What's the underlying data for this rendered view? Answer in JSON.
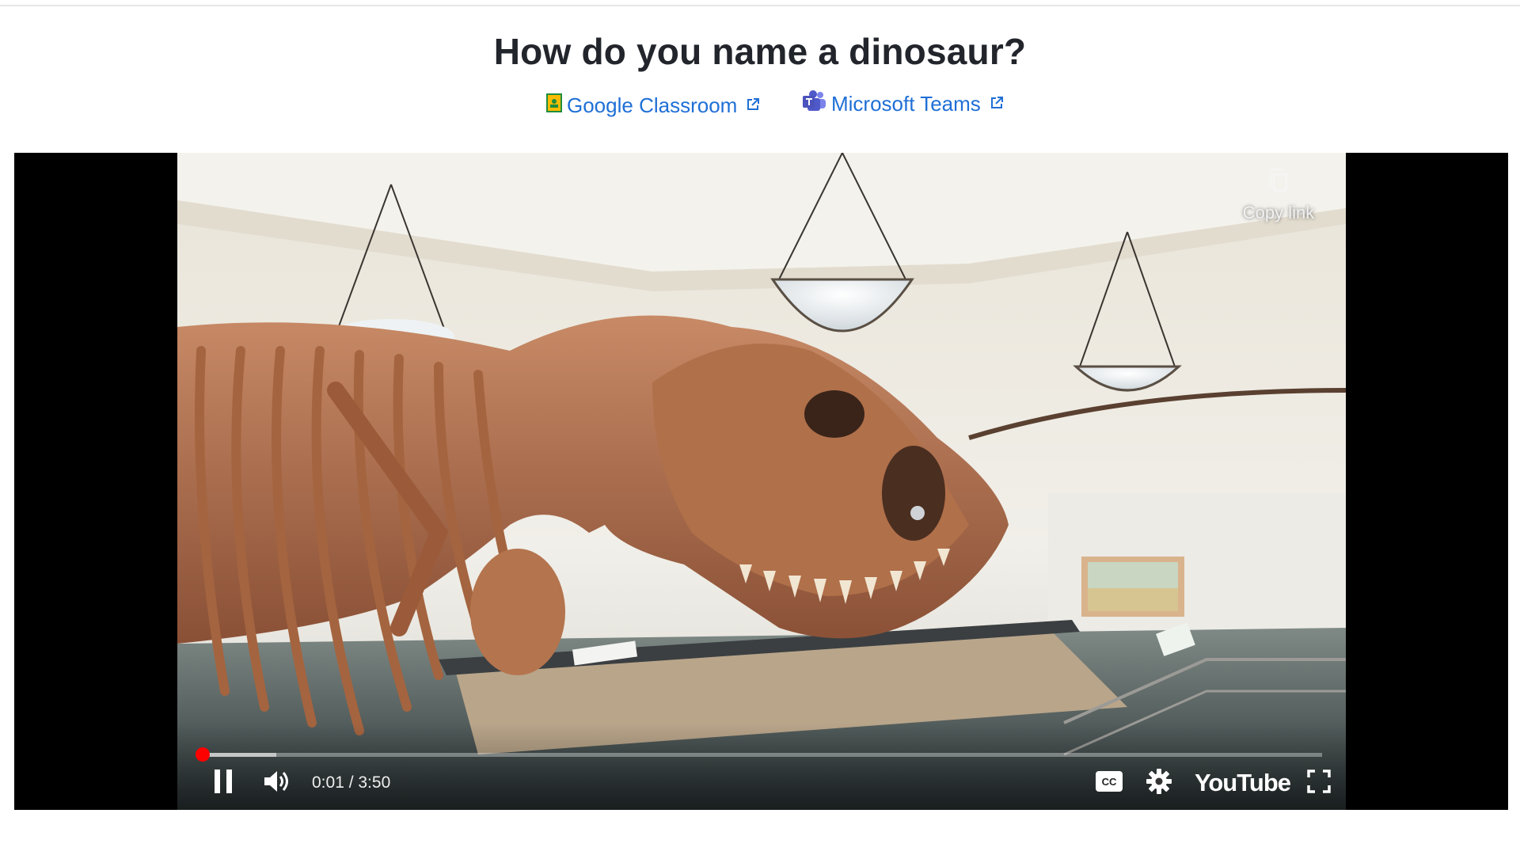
{
  "page": {
    "title": "How do you name a dinosaur?"
  },
  "share": {
    "google_classroom": "Google Classroom",
    "microsoft_teams": "Microsoft Teams"
  },
  "player": {
    "copy_link_label": "Copy link",
    "current_time": "0:01",
    "duration": "3:50",
    "time_display": "0:01 / 3:50",
    "played_fraction": 0.004,
    "buffered_fraction": 0.07,
    "state": "playing",
    "brand": "YouTube",
    "icons": [
      "pause-icon",
      "volume-icon",
      "captions-icon",
      "settings-icon",
      "fullscreen-icon",
      "copy-icon"
    ],
    "accent_color": "#ff0000"
  },
  "colors": {
    "link": "#1f6fd6",
    "title": "#22252b"
  }
}
